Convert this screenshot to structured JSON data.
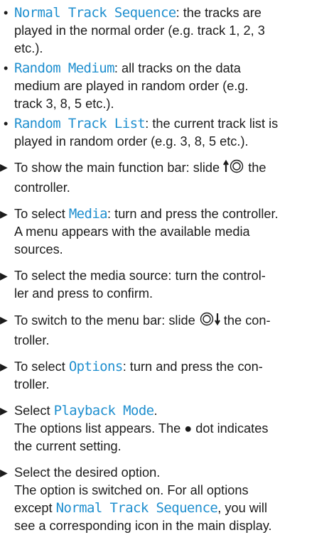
{
  "accent_color": "#1f8fcf",
  "bullets": [
    {
      "term": "Normal Track Sequence",
      "text": ": the tracks are",
      "lines": [
        "played in the normal order (e.g. track 1, 2, 3",
        "etc.)."
      ]
    },
    {
      "term": "Random Medium",
      "text": ": all tracks on the data",
      "lines": [
        "medium are played in random order (e.g.",
        "track 3, 8, 5 etc.)."
      ]
    },
    {
      "term": "Random Track List",
      "text": ": the current track list is",
      "lines": [
        "played in random order (e.g. 3, 8, 5 etc.)."
      ]
    }
  ],
  "steps": {
    "s1": {
      "a": "To show the main function bar: slide ",
      "icon": "slide-up-controller-icon",
      "b": " the",
      "c": "controller."
    },
    "s2": {
      "a": "To select ",
      "term": "Media",
      "b": ": turn and press the controller.",
      "c": "A menu appears with the available media",
      "d": "sources."
    },
    "s3": {
      "a": "To select the media source: turn the control-",
      "b": "ler and press to confirm."
    },
    "s4": {
      "a": "To switch to the menu bar: slide ",
      "icon": "slide-down-controller-icon",
      "b": " the con-",
      "c": "troller."
    },
    "s5": {
      "a": "To select ",
      "term": "Options",
      "b": ": turn and press the con-",
      "c": "troller."
    },
    "s6": {
      "a": "Select ",
      "term": "Playback Mode",
      "b": ".",
      "c": "The options list appears. The ● dot indicates",
      "d": "the current setting."
    },
    "s7": {
      "a": "Select the desired option.",
      "b": "The option is switched on. For all options",
      "c": "except ",
      "term": "Normal Track Sequence",
      "d": ", you will",
      "e": "see a corresponding icon in the main display."
    }
  }
}
